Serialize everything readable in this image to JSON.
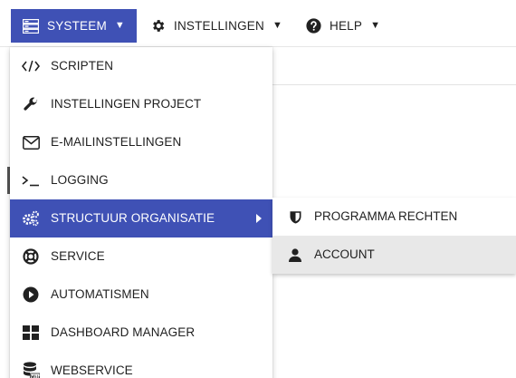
{
  "topbar": {
    "menus": [
      {
        "label": "SYSTEEM",
        "icon": "server-icon",
        "active": true
      },
      {
        "label": "INSTELLINGEN",
        "icon": "gear-icon",
        "active": false
      },
      {
        "label": "HELP",
        "icon": "help-icon",
        "active": false
      }
    ]
  },
  "system_menu": {
    "items": [
      {
        "label": "SCRIPTEN",
        "icon": "code-icon"
      },
      {
        "label": "INSTELLINGEN PROJECT",
        "icon": "wrench-icon"
      },
      {
        "label": "E-MAILINSTELLINGEN",
        "icon": "envelope-icon"
      },
      {
        "label": "LOGGING",
        "icon": "terminal-icon"
      },
      {
        "label": "STRUCTUUR ORGANISATIE",
        "icon": "gears-icon",
        "active": true
      },
      {
        "label": "SERVICE",
        "icon": "lifebuoy-icon"
      },
      {
        "label": "AUTOMATISMEN",
        "icon": "play-circle-icon"
      },
      {
        "label": "DASHBOARD MANAGER",
        "icon": "dashboard-grid-icon"
      },
      {
        "label": "WEBSERVICE",
        "icon": "database-web-icon"
      }
    ]
  },
  "submenu": {
    "items": [
      {
        "label": "PROGRAMMA RECHTEN",
        "icon": "shield-icon"
      },
      {
        "label": "ACCOUNT",
        "icon": "user-icon",
        "hover": true
      }
    ]
  },
  "colors": {
    "accent": "#3f51b5",
    "hover": "#e8e8e8",
    "text": "#212121"
  }
}
